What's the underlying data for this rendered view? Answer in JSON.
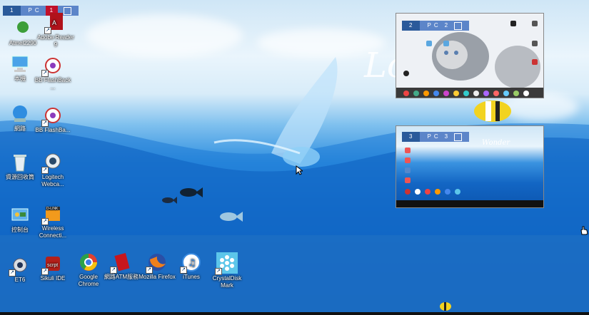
{
  "pc_badges": [
    {
      "number": "1",
      "label": "P C",
      "index": "1"
    },
    {
      "number": "2",
      "label": "P C",
      "index": "2"
    },
    {
      "number": "3",
      "label": "P C",
      "index": "3"
    }
  ],
  "desktop_icons": [
    {
      "label": "Atmel2290",
      "icon": "app-icon"
    },
    {
      "label": "Adobe Reader 9",
      "icon": "pdf-icon"
    },
    {
      "label": "本機",
      "icon": "computer-icon"
    },
    {
      "label": "BB FlashBack ...",
      "icon": "flashback-icon"
    },
    {
      "label": "網路",
      "icon": "network-icon"
    },
    {
      "label": "BB FlashBa...",
      "icon": "flashback-icon"
    },
    {
      "label": "資源回收筒",
      "icon": "recycle-bin-icon"
    },
    {
      "label": "Logitech Webca...",
      "icon": "webcam-icon"
    },
    {
      "label": "控制台",
      "icon": "control-panel-icon"
    },
    {
      "label": "Wireless Connecti...",
      "icon": "wireless-icon"
    },
    {
      "label": "ET6",
      "icon": "et6-icon"
    },
    {
      "label": "Sikuli IDE",
      "icon": "sikuli-icon"
    },
    {
      "label": "Google Chrome",
      "icon": "chrome-icon"
    },
    {
      "label": "網路ATM服務",
      "icon": "atm-icon"
    },
    {
      "label": "Mozilla Firefox",
      "icon": "firefox-icon"
    },
    {
      "label": "iTunes",
      "icon": "itunes-icon"
    },
    {
      "label": "CrystalDisk Mark",
      "icon": "crystaldisk-icon"
    }
  ],
  "thumbnails": {
    "pc2_wallpaper_text": "",
    "pc3_wallpaper_text": "Wonder"
  },
  "wallpaper_text": "Lo",
  "colors": {
    "badge_dark": "#2a5a9a",
    "badge_light": "#5c85c9",
    "sea_deep": "#0b5bb8",
    "sky": "#d8ecf9"
  }
}
